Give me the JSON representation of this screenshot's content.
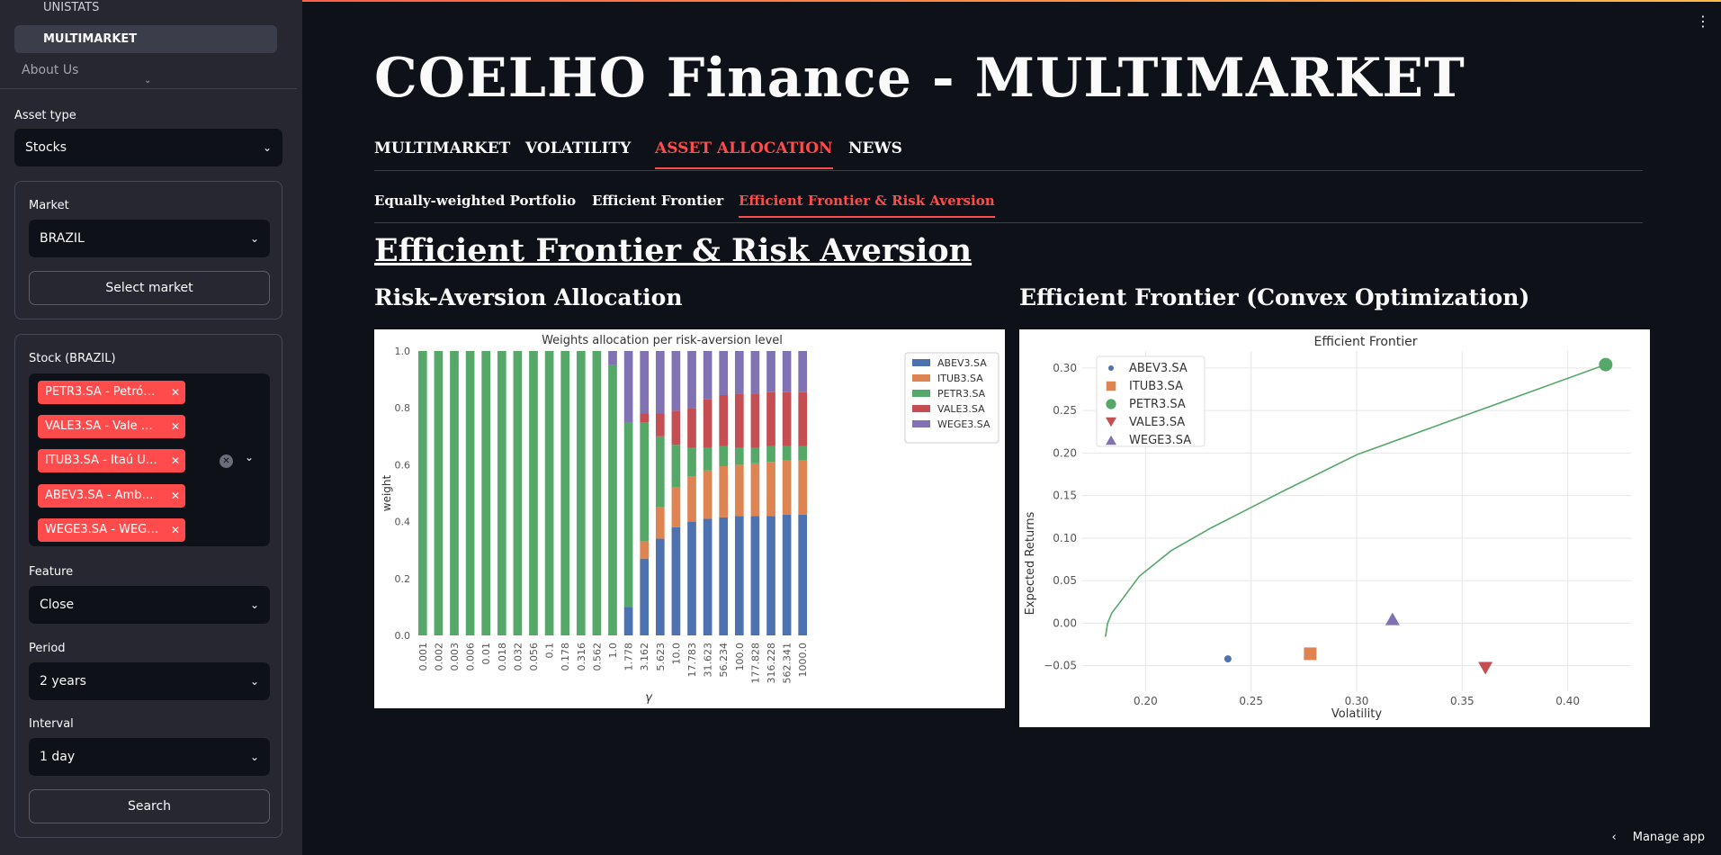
{
  "sidebar": {
    "nav": [
      "UNISTATS",
      "MULTIMARKET"
    ],
    "about": "About Us",
    "asset_type": {
      "label": "Asset type",
      "value": "Stocks"
    },
    "market": {
      "label": "Market",
      "value": "BRAZIL",
      "button": "Select market"
    },
    "stock": {
      "label": "Stock (BRAZIL)",
      "tags": [
        "PETR3.SA - Petró…",
        "VALE3.SA - Vale …",
        "ITUB3.SA - Itaú U…",
        "ABEV3.SA - Amb…",
        "WEGE3.SA - WEG…"
      ]
    },
    "feature": {
      "label": "Feature",
      "value": "Close"
    },
    "period": {
      "label": "Period",
      "value": "2 years"
    },
    "interval": {
      "label": "Interval",
      "value": "1 day"
    },
    "search_button": "Search"
  },
  "main": {
    "title": "COELHO Finance - MULTIMARKET",
    "tabs": [
      "MULTIMARKET",
      "VOLATILITY",
      "ASSET ALLOCATION",
      "NEWS"
    ],
    "subtabs": [
      "Equally-weighted Portfolio",
      "Efficient Frontier",
      "Efficient Frontier & Risk Aversion"
    ],
    "section_title": "Efficient Frontier & Risk Aversion",
    "left_title": "Risk-Aversion Allocation",
    "right_title": "Efficient Frontier (Convex Optimization)",
    "manage_app": "Manage app"
  },
  "colors": {
    "accent": "#ff4b4b",
    "abev": "#4c72b0",
    "itub": "#dd8452",
    "petr": "#55a868",
    "vale": "#c44e52",
    "wege": "#8172b3"
  },
  "chart_data": [
    {
      "type": "bar",
      "stacked": true,
      "title": "Weights allocation per risk-aversion level",
      "xlabel": "γ",
      "ylabel": "weight",
      "ylim": [
        0,
        1
      ],
      "yticks": [
        "0.0",
        "0.2",
        "0.4",
        "0.6",
        "0.8",
        "1.0"
      ],
      "legend": "upper-right",
      "categories": [
        "0.001",
        "0.002",
        "0.003",
        "0.006",
        "0.01",
        "0.018",
        "0.032",
        "0.056",
        "0.1",
        "0.178",
        "0.316",
        "0.562",
        "1.0",
        "1.778",
        "3.162",
        "5.623",
        "10.0",
        "17.783",
        "31.623",
        "56.234",
        "100.0",
        "177.828",
        "316.228",
        "562.341",
        "1000.0"
      ],
      "series": [
        {
          "name": "ABEV3.SA",
          "values": [
            0,
            0,
            0,
            0,
            0,
            0,
            0,
            0,
            0,
            0,
            0,
            0,
            0,
            0.1,
            0.27,
            0.34,
            0.38,
            0.4,
            0.41,
            0.415,
            0.42,
            0.42,
            0.42,
            0.425,
            0.425
          ]
        },
        {
          "name": "ITUB3.SA",
          "values": [
            0,
            0,
            0,
            0,
            0,
            0,
            0,
            0,
            0,
            0,
            0,
            0,
            0,
            0,
            0.06,
            0.11,
            0.14,
            0.16,
            0.17,
            0.18,
            0.18,
            0.185,
            0.19,
            0.19,
            0.19
          ]
        },
        {
          "name": "PETR3.SA",
          "values": [
            1,
            1,
            1,
            1,
            1,
            1,
            1,
            1,
            1,
            1,
            1,
            1,
            0.95,
            0.65,
            0.42,
            0.25,
            0.15,
            0.1,
            0.08,
            0.07,
            0.06,
            0.055,
            0.055,
            0.05,
            0.05
          ]
        },
        {
          "name": "VALE3.SA",
          "values": [
            0,
            0,
            0,
            0,
            0,
            0,
            0,
            0,
            0,
            0,
            0,
            0,
            0,
            0,
            0.03,
            0.08,
            0.12,
            0.14,
            0.17,
            0.18,
            0.19,
            0.19,
            0.19,
            0.19,
            0.19
          ]
        },
        {
          "name": "WEGE3.SA",
          "values": [
            0,
            0,
            0,
            0,
            0,
            0,
            0,
            0,
            0,
            0,
            0,
            0,
            0.05,
            0.25,
            0.22,
            0.22,
            0.21,
            0.2,
            0.17,
            0.155,
            0.15,
            0.15,
            0.145,
            0.145,
            0.145
          ]
        }
      ]
    },
    {
      "type": "scatter",
      "title": "Efficient Frontier",
      "xlabel": "Volatility",
      "ylabel": "Expected Returns",
      "xlim": [
        0.17,
        0.43
      ],
      "ylim": [
        -0.08,
        0.32
      ],
      "xticks": [
        "0.20",
        "0.25",
        "0.30",
        "0.35",
        "0.40"
      ],
      "yticks": [
        "−0.05",
        "0.00",
        "0.05",
        "0.10",
        "0.15",
        "0.20",
        "0.25",
        "0.30"
      ],
      "grid": true,
      "legend": "upper-left",
      "frontier": {
        "x": [
          0.181,
          0.182,
          0.184,
          0.188,
          0.197,
          0.212,
          0.231,
          0.265,
          0.3,
          0.36,
          0.418
        ],
        "y": [
          -0.016,
          0.0,
          0.012,
          0.025,
          0.055,
          0.085,
          0.112,
          0.155,
          0.198,
          0.252,
          0.304
        ]
      },
      "points": [
        {
          "name": "ABEV3.SA",
          "x": 0.239,
          "y": -0.042,
          "marker": "circle-small"
        },
        {
          "name": "ITUB3.SA",
          "x": 0.278,
          "y": -0.036,
          "marker": "square"
        },
        {
          "name": "PETR3.SA",
          "x": 0.418,
          "y": 0.304,
          "marker": "circle"
        },
        {
          "name": "VALE3.SA",
          "x": 0.361,
          "y": -0.053,
          "marker": "triangle-down"
        },
        {
          "name": "WEGE3.SA",
          "x": 0.317,
          "y": 0.005,
          "marker": "triangle-up"
        }
      ]
    }
  ]
}
